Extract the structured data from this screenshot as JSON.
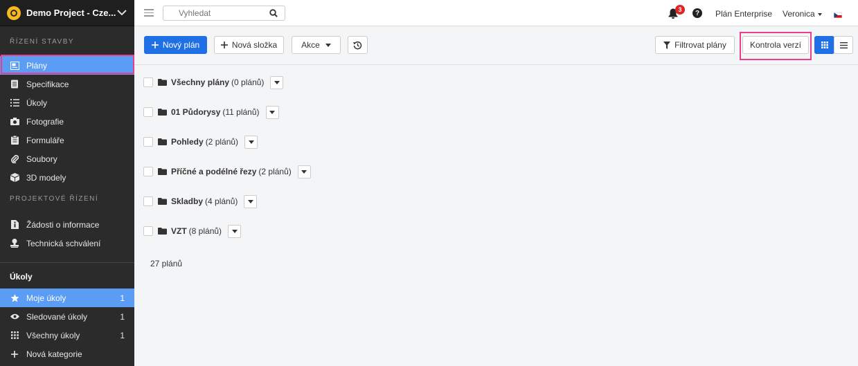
{
  "project": {
    "name": "Demo Project - Cze..."
  },
  "sidebar": {
    "section1_title": "ŘÍZENÍ STAVBY",
    "section1_items": [
      {
        "label": "Plány",
        "icon": "plans-icon"
      },
      {
        "label": "Specifikace",
        "icon": "specs-icon"
      },
      {
        "label": "Úkoly",
        "icon": "list-icon"
      },
      {
        "label": "Fotografie",
        "icon": "camera-icon"
      },
      {
        "label": "Formuláře",
        "icon": "clipboard-icon"
      },
      {
        "label": "Soubory",
        "icon": "paperclip-icon"
      },
      {
        "label": "3D modely",
        "icon": "cube-icon"
      }
    ],
    "section2_title": "PROJEKTOVÉ ŘÍZENÍ",
    "section2_items": [
      {
        "label": "Žádosti o informace",
        "icon": "info-doc-icon"
      },
      {
        "label": "Technická schválení",
        "icon": "stamp-icon"
      }
    ],
    "tasks_title": "Úkoly",
    "task_items": [
      {
        "label": "Moje úkoly",
        "count": "1",
        "icon": "star-icon"
      },
      {
        "label": "Sledované úkoly",
        "count": "1",
        "icon": "eye-icon"
      },
      {
        "label": "Všechny úkoly",
        "count": "1",
        "icon": "grid-dots-icon"
      },
      {
        "label": "Nová kategorie",
        "count": "",
        "icon": "plus-icon"
      }
    ]
  },
  "topbar": {
    "search_placeholder": "Vyhledat",
    "notif_count": "3",
    "help": "?",
    "plan_label": "Plán Enterprise",
    "user_name": "Veronica"
  },
  "toolbar": {
    "new_plan": "Nový plán",
    "new_folder": "Nová složka",
    "actions": "Akce",
    "filter": "Filtrovat plány",
    "version_check": "Kontrola verzí"
  },
  "folders": [
    {
      "name": "Všechny plány",
      "count": "(0 plánů)"
    },
    {
      "name": "01 Půdorysy",
      "count": "(11 plánů)"
    },
    {
      "name": "Pohledy",
      "count": "(2 plánů)"
    },
    {
      "name": "Příčné a podélné řezy",
      "count": "(2 plánů)"
    },
    {
      "name": "Skladby",
      "count": "(4 plánů)"
    },
    {
      "name": "VZT",
      "count": "(8 plánů)"
    }
  ],
  "total_label": "27 plánů",
  "colors": {
    "sidebar_bg": "#2b2b2b",
    "primary": "#1f6fe5",
    "active_item": "#5b9cf5",
    "highlight": "#e83e8c",
    "badge": "#e02424"
  }
}
